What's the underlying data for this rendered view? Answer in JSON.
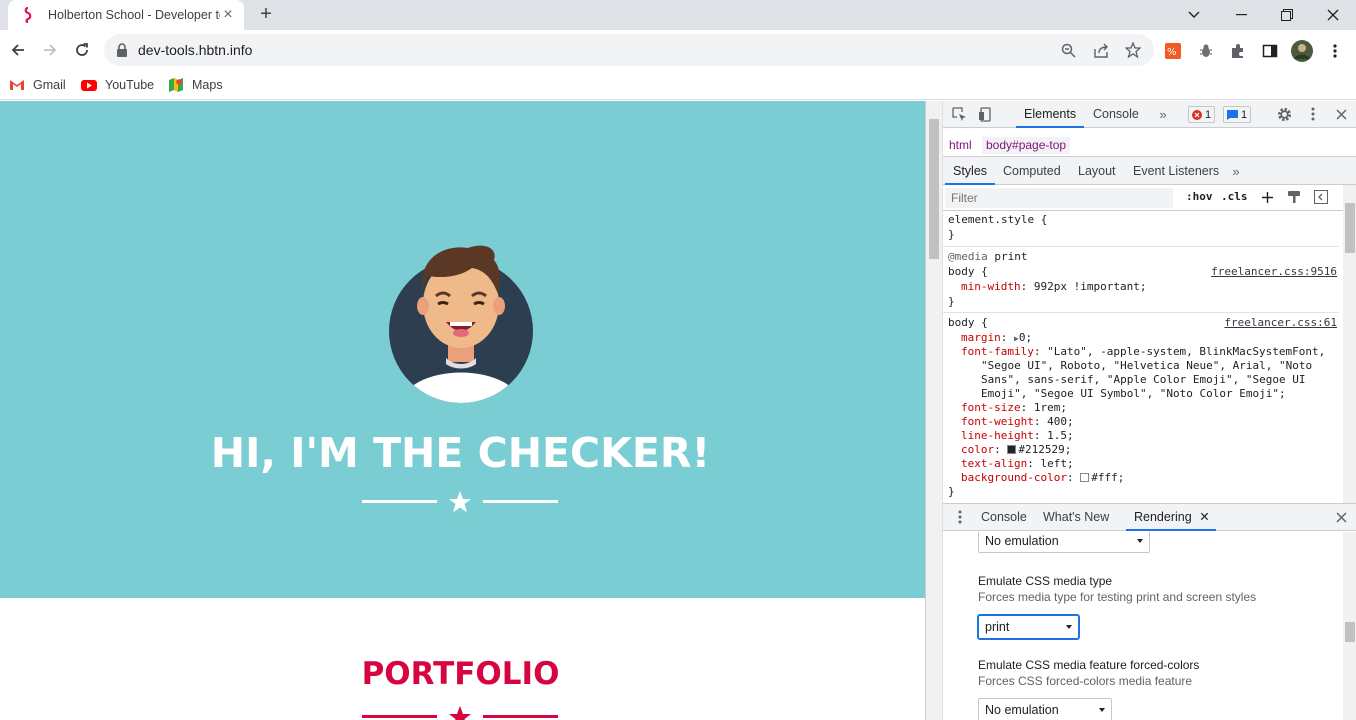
{
  "browser": {
    "tab_title": "Holberton School - Developer to",
    "url": "dev-tools.hbtn.info",
    "bookmarks": [
      {
        "label": "Gmail"
      },
      {
        "label": "YouTube"
      },
      {
        "label": "Maps"
      }
    ]
  },
  "page": {
    "hero_title": "HI, I'M THE CHECKER!",
    "section_title": "PORTFOLIO",
    "colors": {
      "masthead_bg": "#7acdd3",
      "accent": "#d8043f",
      "white": "#ffffff",
      "avatar_bg": "#2c3e50"
    }
  },
  "devtools": {
    "tabs": [
      "Elements",
      "Console"
    ],
    "error_count": "1",
    "message_count": "1",
    "breadcrumbs": [
      "html",
      "body#page-top"
    ],
    "subtabs": [
      "Styles",
      "Computed",
      "Layout",
      "Event Listeners"
    ],
    "filter_placeholder": "Filter",
    "hov_label": ":hov",
    "cls_label": ".cls",
    "styles": {
      "element_style_open": "element.style {",
      "close_brace": "}",
      "media_line": "print",
      "media_keyword": "@media",
      "body_selector": "body {",
      "rule1_source": "freelancer.css:9516",
      "rule1_prop": "min-width",
      "rule1_val": "992px !important;",
      "rule2_source": "freelancer.css:61",
      "margin_prop": "margin",
      "margin_val": "0;",
      "ff_prop": "font-family",
      "ff_val1": "\"Lato\", -apple-system, BlinkMacSystemFont,",
      "ff_val2": "\"Segoe UI\", Roboto, \"Helvetica Neue\", Arial, \"Noto",
      "ff_val3": "Sans\", sans-serif, \"Apple Color Emoji\", \"Segoe UI",
      "ff_val4": "Emoji\", \"Segoe UI Symbol\", \"Noto Color Emoji\";",
      "fs_prop": "font-size",
      "fs_val": "1rem;",
      "fw_prop": "font-weight",
      "fw_val": "400;",
      "lh_prop": "line-height",
      "lh_val": "1.5;",
      "color_prop": "color",
      "color_val": "#212529;",
      "ta_prop": "text-align",
      "ta_val": "left;",
      "bg_prop": "background-color",
      "bg_val": "#fff;"
    },
    "drawer": {
      "tabs": [
        "Console",
        "What's New",
        "Rendering"
      ],
      "top_select_value": "No emulation",
      "media_type_title": "Emulate CSS media type",
      "media_type_desc": "Forces media type for testing print and screen styles",
      "media_type_value": "print",
      "forced_colors_title": "Emulate CSS media feature forced-colors",
      "forced_colors_desc": "Forces CSS forced-colors media feature",
      "forced_colors_value": "No emulation"
    }
  }
}
